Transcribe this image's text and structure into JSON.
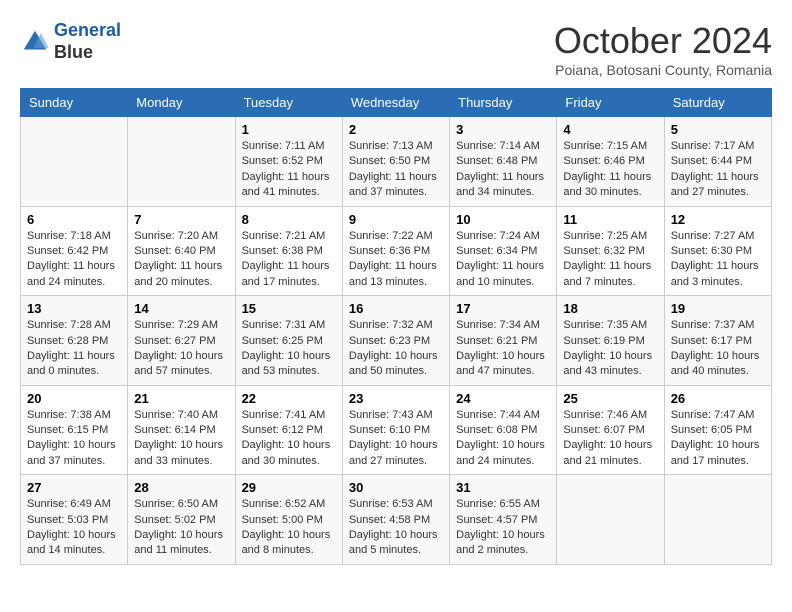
{
  "header": {
    "logo_line1": "General",
    "logo_line2": "Blue",
    "month": "October 2024",
    "location": "Poiana, Botosani County, Romania"
  },
  "days_of_week": [
    "Sunday",
    "Monday",
    "Tuesday",
    "Wednesday",
    "Thursday",
    "Friday",
    "Saturday"
  ],
  "weeks": [
    [
      {
        "day": "",
        "info": ""
      },
      {
        "day": "",
        "info": ""
      },
      {
        "day": "1",
        "info": "Sunrise: 7:11 AM\nSunset: 6:52 PM\nDaylight: 11 hours and 41 minutes."
      },
      {
        "day": "2",
        "info": "Sunrise: 7:13 AM\nSunset: 6:50 PM\nDaylight: 11 hours and 37 minutes."
      },
      {
        "day": "3",
        "info": "Sunrise: 7:14 AM\nSunset: 6:48 PM\nDaylight: 11 hours and 34 minutes."
      },
      {
        "day": "4",
        "info": "Sunrise: 7:15 AM\nSunset: 6:46 PM\nDaylight: 11 hours and 30 minutes."
      },
      {
        "day": "5",
        "info": "Sunrise: 7:17 AM\nSunset: 6:44 PM\nDaylight: 11 hours and 27 minutes."
      }
    ],
    [
      {
        "day": "6",
        "info": "Sunrise: 7:18 AM\nSunset: 6:42 PM\nDaylight: 11 hours and 24 minutes."
      },
      {
        "day": "7",
        "info": "Sunrise: 7:20 AM\nSunset: 6:40 PM\nDaylight: 11 hours and 20 minutes."
      },
      {
        "day": "8",
        "info": "Sunrise: 7:21 AM\nSunset: 6:38 PM\nDaylight: 11 hours and 17 minutes."
      },
      {
        "day": "9",
        "info": "Sunrise: 7:22 AM\nSunset: 6:36 PM\nDaylight: 11 hours and 13 minutes."
      },
      {
        "day": "10",
        "info": "Sunrise: 7:24 AM\nSunset: 6:34 PM\nDaylight: 11 hours and 10 minutes."
      },
      {
        "day": "11",
        "info": "Sunrise: 7:25 AM\nSunset: 6:32 PM\nDaylight: 11 hours and 7 minutes."
      },
      {
        "day": "12",
        "info": "Sunrise: 7:27 AM\nSunset: 6:30 PM\nDaylight: 11 hours and 3 minutes."
      }
    ],
    [
      {
        "day": "13",
        "info": "Sunrise: 7:28 AM\nSunset: 6:28 PM\nDaylight: 11 hours and 0 minutes."
      },
      {
        "day": "14",
        "info": "Sunrise: 7:29 AM\nSunset: 6:27 PM\nDaylight: 10 hours and 57 minutes."
      },
      {
        "day": "15",
        "info": "Sunrise: 7:31 AM\nSunset: 6:25 PM\nDaylight: 10 hours and 53 minutes."
      },
      {
        "day": "16",
        "info": "Sunrise: 7:32 AM\nSunset: 6:23 PM\nDaylight: 10 hours and 50 minutes."
      },
      {
        "day": "17",
        "info": "Sunrise: 7:34 AM\nSunset: 6:21 PM\nDaylight: 10 hours and 47 minutes."
      },
      {
        "day": "18",
        "info": "Sunrise: 7:35 AM\nSunset: 6:19 PM\nDaylight: 10 hours and 43 minutes."
      },
      {
        "day": "19",
        "info": "Sunrise: 7:37 AM\nSunset: 6:17 PM\nDaylight: 10 hours and 40 minutes."
      }
    ],
    [
      {
        "day": "20",
        "info": "Sunrise: 7:38 AM\nSunset: 6:15 PM\nDaylight: 10 hours and 37 minutes."
      },
      {
        "day": "21",
        "info": "Sunrise: 7:40 AM\nSunset: 6:14 PM\nDaylight: 10 hours and 33 minutes."
      },
      {
        "day": "22",
        "info": "Sunrise: 7:41 AM\nSunset: 6:12 PM\nDaylight: 10 hours and 30 minutes."
      },
      {
        "day": "23",
        "info": "Sunrise: 7:43 AM\nSunset: 6:10 PM\nDaylight: 10 hours and 27 minutes."
      },
      {
        "day": "24",
        "info": "Sunrise: 7:44 AM\nSunset: 6:08 PM\nDaylight: 10 hours and 24 minutes."
      },
      {
        "day": "25",
        "info": "Sunrise: 7:46 AM\nSunset: 6:07 PM\nDaylight: 10 hours and 21 minutes."
      },
      {
        "day": "26",
        "info": "Sunrise: 7:47 AM\nSunset: 6:05 PM\nDaylight: 10 hours and 17 minutes."
      }
    ],
    [
      {
        "day": "27",
        "info": "Sunrise: 6:49 AM\nSunset: 5:03 PM\nDaylight: 10 hours and 14 minutes."
      },
      {
        "day": "28",
        "info": "Sunrise: 6:50 AM\nSunset: 5:02 PM\nDaylight: 10 hours and 11 minutes."
      },
      {
        "day": "29",
        "info": "Sunrise: 6:52 AM\nSunset: 5:00 PM\nDaylight: 10 hours and 8 minutes."
      },
      {
        "day": "30",
        "info": "Sunrise: 6:53 AM\nSunset: 4:58 PM\nDaylight: 10 hours and 5 minutes."
      },
      {
        "day": "31",
        "info": "Sunrise: 6:55 AM\nSunset: 4:57 PM\nDaylight: 10 hours and 2 minutes."
      },
      {
        "day": "",
        "info": ""
      },
      {
        "day": "",
        "info": ""
      }
    ]
  ]
}
